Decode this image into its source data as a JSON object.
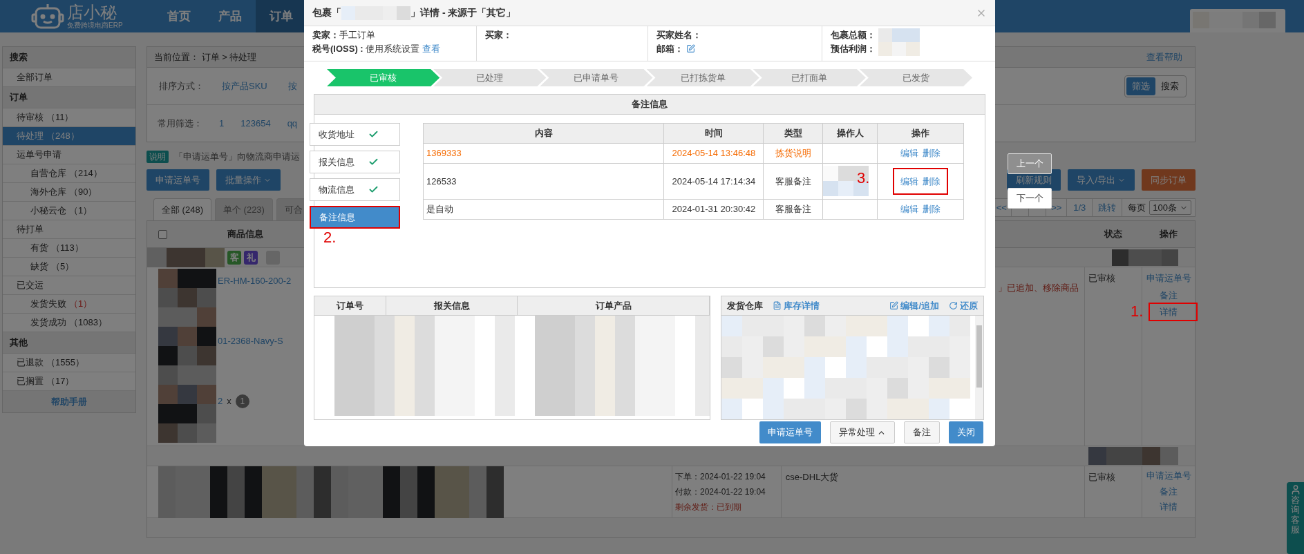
{
  "header": {
    "logo_name": "店小秘",
    "logo_tagline": "免费跨境电商ERP",
    "nav": [
      {
        "label": "首页",
        "selected": false
      },
      {
        "label": "产品",
        "selected": false
      },
      {
        "label": "订单",
        "selected": true
      }
    ]
  },
  "sidebar": {
    "sections": [
      {
        "title": "搜索",
        "items": [
          {
            "label": "全部订单",
            "selected": false
          }
        ]
      },
      {
        "title": "订单",
        "items": [
          {
            "label": "待审核",
            "count": "（11）",
            "selected": false
          },
          {
            "label": "待处理",
            "count": "（248）",
            "selected": true
          },
          {
            "label": "运单号申请",
            "selected": false,
            "children": [
              {
                "label": "自营仓库",
                "count": "（214）",
                "selected": false
              },
              {
                "label": "海外仓库",
                "count": "（90）",
                "selected": false
              },
              {
                "label": "小秘云仓",
                "count": "（1）",
                "selected": false
              }
            ]
          },
          {
            "label": "待打单",
            "selected": false,
            "children": [
              {
                "label": "有货",
                "count": "（113）",
                "selected": false
              },
              {
                "label": "缺货",
                "count": "（5）",
                "selected": false
              }
            ]
          },
          {
            "label": "已交运",
            "selected": false,
            "children": [
              {
                "label": "发货失败",
                "count": "（1）",
                "alert": true,
                "selected": false
              },
              {
                "label": "发货成功",
                "count": "（1083）",
                "selected": false
              }
            ]
          }
        ]
      },
      {
        "title": "其他",
        "items": [
          {
            "label": "已退款",
            "count": "（1555）",
            "selected": false
          },
          {
            "label": "已搁置",
            "count": "（17）",
            "selected": false
          }
        ]
      }
    ],
    "footer": "帮助手册"
  },
  "main": {
    "breadcrumb": {
      "label": "当前位置：",
      "path": "订单 > 待处理"
    },
    "help_link": "查看帮助",
    "sort": {
      "label": "排序方式：",
      "options": [
        "按产品SKU",
        "按"
      ]
    },
    "filters": {
      "label": "常用筛选：",
      "options": [
        "1",
        "123654",
        "qq"
      ]
    },
    "mode_toggle": [
      {
        "label": "筛选",
        "selected": true
      },
      {
        "label": "搜索",
        "selected": false
      }
    ],
    "notice": {
      "badge": "说明",
      "text": "「申请运单号」向物流商申请运"
    },
    "actions_left": [
      {
        "label": "申请运单号",
        "dropdown": false
      },
      {
        "label": "批量操作",
        "dropdown": true
      }
    ],
    "actions_right": [
      {
        "label": "刷新规则",
        "kind": "primary",
        "dropdown": false
      },
      {
        "label": "导入/导出",
        "kind": "primary",
        "dropdown": true
      },
      {
        "label": "同步订单",
        "kind": "warning",
        "dropdown": false
      }
    ],
    "pagination": {
      "first": "<<",
      "last": ">>",
      "page": "1/3",
      "jump": "跳转",
      "per_page_label": "每页",
      "per_page": "100条"
    },
    "tabs": [
      {
        "label": "全部 (248)",
        "selected": true
      },
      {
        "label": "单个 (223)",
        "selected": false
      },
      {
        "label": "可合",
        "selected": false
      }
    ],
    "table": {
      "select_all": {
        "checked": false
      },
      "columns": [
        "商品信息",
        "状态",
        "操作"
      ],
      "rows": [
        {
          "tags": [
            {
              "label": "客",
              "kind": "customer"
            },
            {
              "label": "礼",
              "kind": "gift"
            }
          ],
          "skus": [
            "ER-HM-160-200-2",
            "01-2368-Navy-S"
          ],
          "quantity": "2",
          "times_sign": "x",
          "quantity_badge": "1",
          "message": "」已追加、移除商品",
          "status": "已审核",
          "actions": [
            "申请运单号",
            "备注",
            "详情"
          ],
          "marker": "1."
        },
        {
          "order_time": "下单：2024-01-22 19:04",
          "pay_time": "付款：2024-01-22 19:04",
          "deadline": "剩余发货：已到期",
          "logistics": "cse-DHL大货",
          "status": "已审核",
          "actions": [
            "申请运单号",
            "备注",
            "详情"
          ]
        }
      ]
    }
  },
  "modal": {
    "title_prefix": "包裹「",
    "title_suffix": "」详情 - 来源于「其它」",
    "info": {
      "seller_label": "卖家：",
      "seller": "手工订单",
      "tax_label": "税号(IOSS) :",
      "tax_value": "使用系统设置",
      "tax_link": "查看",
      "buyer_label": "买家：",
      "buyer_name_label": "买家姓名：",
      "email_label": "邮箱：",
      "total_label": "包裹总额：",
      "profit_label": "预估利润："
    },
    "steps": [
      {
        "label": "已审核",
        "done": true
      },
      {
        "label": "已处理",
        "done": false
      },
      {
        "label": "已申请单号",
        "done": false
      },
      {
        "label": "已打拣货单",
        "done": false
      },
      {
        "label": "已打面单",
        "done": false
      },
      {
        "label": "已发货",
        "done": false
      }
    ],
    "remark_panel": {
      "title": "备注信息",
      "tabs": [
        {
          "label": "收货地址",
          "checked": true,
          "selected": false
        },
        {
          "label": "报关信息",
          "checked": true,
          "selected": false
        },
        {
          "label": "物流信息",
          "checked": true,
          "selected": false
        },
        {
          "label": "备注信息",
          "checked": false,
          "selected": true,
          "marker": "2."
        }
      ],
      "columns": [
        "内容",
        "时间",
        "类型",
        "操作人",
        "操作"
      ],
      "rows": [
        {
          "content": "1369333",
          "time": "2024-05-14 13:46:48",
          "type": "拣货说明",
          "kind": "picking",
          "actions": [
            "编辑",
            "删除"
          ]
        },
        {
          "content": "126533",
          "time": "2024-05-14 17:14:34",
          "type": "客服备注",
          "kind": "service",
          "actions": [
            "编辑",
            "删除"
          ],
          "marker": "3."
        },
        {
          "content": "是自动",
          "time": "2024-01-31 20:30:42",
          "type": "客服备注",
          "kind": "service",
          "actions": [
            "编辑",
            "删除"
          ]
        }
      ]
    },
    "order_columns": [
      "订单号",
      "报关信息",
      "订单产品"
    ],
    "warehouse": {
      "label": "发货仓库",
      "stock_link": "库存详情",
      "edit_link": "编辑/追加",
      "restore_link": "还原"
    },
    "footer": [
      {
        "label": "申请运单号",
        "kind": "primary",
        "dropdown": false
      },
      {
        "label": "异常处理",
        "kind": "default",
        "dropdown": true
      },
      {
        "label": "备注",
        "kind": "default",
        "dropdown": false
      },
      {
        "label": "关闭",
        "kind": "primary",
        "dropdown": false
      }
    ]
  },
  "record_nav": [
    {
      "label": "上一个",
      "disabled": true
    },
    {
      "label": "下一个",
      "disabled": false
    }
  ],
  "support_tab": {
    "label": "咨询客服"
  }
}
